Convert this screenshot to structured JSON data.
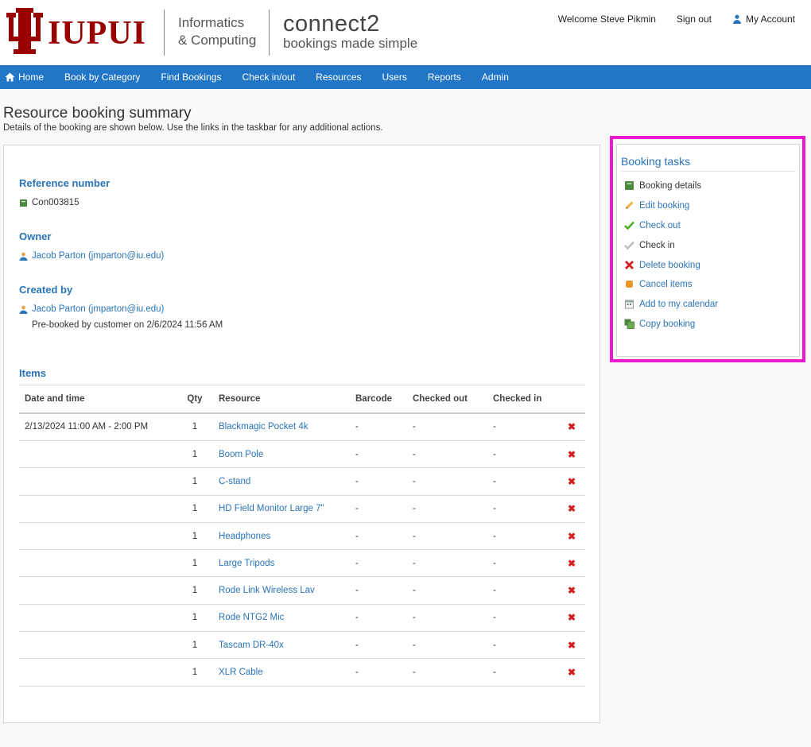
{
  "header": {
    "logo_text": "IUPUI",
    "dept_line1": "Informatics",
    "dept_line2": "& Computing",
    "app_name": "connect2",
    "app_tagline": "bookings made simple",
    "welcome": "Welcome Steve Pikmin",
    "sign_out": "Sign out",
    "my_account": "My Account"
  },
  "nav": {
    "items": [
      "Home",
      "Book by Category",
      "Find Bookings",
      "Check in/out",
      "Resources",
      "Users",
      "Reports",
      "Admin"
    ]
  },
  "page": {
    "title": "Resource booking summary",
    "description": "Details of the booking are shown below. Use the links in the taskbar for any additional actions."
  },
  "booking": {
    "reference_label": "Reference number",
    "reference_value": "Con003815",
    "owner_label": "Owner",
    "owner_value": "Jacob Parton (jmparton@iu.edu)",
    "created_label": "Created by",
    "created_value": "Jacob Parton (jmparton@iu.edu)",
    "created_note": "Pre-booked by customer on 2/6/2024 11:56 AM",
    "items_label": "Items"
  },
  "items_table": {
    "headers": [
      "Date and time",
      "Qty",
      "Resource",
      "Barcode",
      "Checked out",
      "Checked in"
    ],
    "rows": [
      {
        "date": "2/13/2024 11:00 AM - 2:00 PM",
        "qty": "1",
        "resource": "Blackmagic Pocket 4k",
        "barcode": "-",
        "out": "-",
        "in": "-"
      },
      {
        "date": "",
        "qty": "1",
        "resource": "Boom Pole",
        "barcode": "-",
        "out": "-",
        "in": "-"
      },
      {
        "date": "",
        "qty": "1",
        "resource": "C-stand",
        "barcode": "-",
        "out": "-",
        "in": "-"
      },
      {
        "date": "",
        "qty": "1",
        "resource": "HD Field Monitor Large 7\"",
        "barcode": "-",
        "out": "-",
        "in": "-"
      },
      {
        "date": "",
        "qty": "1",
        "resource": "Headphones",
        "barcode": "-",
        "out": "-",
        "in": "-"
      },
      {
        "date": "",
        "qty": "1",
        "resource": "Large Tripods",
        "barcode": "-",
        "out": "-",
        "in": "-"
      },
      {
        "date": "",
        "qty": "1",
        "resource": "Rode Link Wireless Lav",
        "barcode": "-",
        "out": "-",
        "in": "-"
      },
      {
        "date": "",
        "qty": "1",
        "resource": "Rode NTG2 Mic",
        "barcode": "-",
        "out": "-",
        "in": "-"
      },
      {
        "date": "",
        "qty": "1",
        "resource": "Tascam DR-40x",
        "barcode": "-",
        "out": "-",
        "in": "-"
      },
      {
        "date": "",
        "qty": "1",
        "resource": "XLR Cable",
        "barcode": "-",
        "out": "-",
        "in": "-"
      }
    ],
    "delete_glyph": "✖"
  },
  "tasks": {
    "title": "Booking tasks",
    "items": [
      {
        "label": "Booking details",
        "icon": "book-icon"
      },
      {
        "label": "Edit booking",
        "icon": "pencil-icon"
      },
      {
        "label": "Check out",
        "icon": "checkmark-green-icon"
      },
      {
        "label": "Check in",
        "icon": "checkmark-gray-icon"
      },
      {
        "label": "Delete booking",
        "icon": "delete-x-icon"
      },
      {
        "label": "Cancel items",
        "icon": "cancel-icon"
      },
      {
        "label": "Add to my calendar",
        "icon": "calendar-icon"
      },
      {
        "label": "Copy booking",
        "icon": "copy-icon"
      }
    ]
  },
  "colors": {
    "brand_red": "#990000",
    "nav_blue": "#2176c7",
    "link_blue": "#2a74b8",
    "highlight_magenta": "#ee1ad0"
  }
}
